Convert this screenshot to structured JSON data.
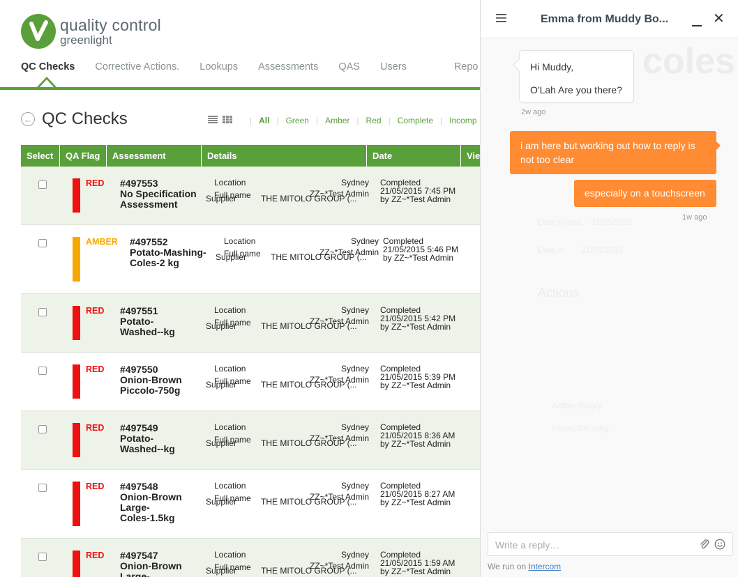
{
  "brand": {
    "name": "quality control",
    "sub": "greenlight"
  },
  "nav": [
    {
      "label": "QC Checks",
      "active": true
    },
    {
      "label": "Corrective Actions."
    },
    {
      "label": "Lookups"
    },
    {
      "label": "Assessments"
    },
    {
      "label": "QAS"
    },
    {
      "label": "Users"
    },
    {
      "label": "Repo"
    }
  ],
  "page": {
    "title": "QC Checks"
  },
  "filters": [
    "All",
    "Green",
    "Amber",
    "Red",
    "Complete",
    "Incomp"
  ],
  "table": {
    "headers": [
      "Select",
      "QA Flag",
      "Assessment",
      "Details",
      "Date",
      "Vie"
    ],
    "detail_labels": {
      "location": "Location",
      "fullname": "Full name",
      "supplier": "Supplier"
    },
    "rows": [
      {
        "flag": "RED",
        "id": "#497553",
        "name_lines": [
          "No Specification",
          "Assessment"
        ],
        "location": "Sydney",
        "fullname": "ZZ~*Test Admin",
        "supplier": "THE MITOLO GROUP (...",
        "status": "Completed",
        "date": "21/05/2015 7:45 PM",
        "by": "by ZZ~*Test Admin"
      },
      {
        "flag": "AMBER",
        "id": "#497552",
        "name_lines": [
          "Potato-Mashing-",
          "Coles-2 kg"
        ],
        "location": "Sydney",
        "fullname": "ZZ~*Test Admin",
        "supplier": "THE MITOLO GROUP (...",
        "status": "Completed",
        "date": "21/05/2015 5:46 PM",
        "by": "by ZZ~*Test Admin"
      },
      {
        "flag": "RED",
        "id": "#497551",
        "name_lines": [
          "Potato-",
          "Washed--kg"
        ],
        "location": "Sydney",
        "fullname": "ZZ~*Test Admin",
        "supplier": "THE MITOLO GROUP (...",
        "status": "Completed",
        "date": "21/05/2015 5:42 PM",
        "by": "by ZZ~*Test Admin"
      },
      {
        "flag": "RED",
        "id": "#497550",
        "name_lines": [
          "Onion-Brown",
          "Piccolo-750g"
        ],
        "location": "Sydney",
        "fullname": "ZZ~*Test Admin",
        "supplier": "THE MITOLO GROUP (...",
        "status": "Completed",
        "date": "21/05/2015 5:39 PM",
        "by": "by ZZ~*Test Admin"
      },
      {
        "flag": "RED",
        "id": "#497549",
        "name_lines": [
          "Potato-",
          "Washed--kg"
        ],
        "location": "Sydney",
        "fullname": "ZZ~*Test Admin",
        "supplier": "THE MITOLO GROUP (...",
        "status": "Completed",
        "date": "21/05/2015 8:36 AM",
        "by": "by ZZ~*Test Admin"
      },
      {
        "flag": "RED",
        "id": "#497548",
        "name_lines": [
          "Onion-Brown",
          "Large-",
          "Coles-1.5kg"
        ],
        "location": "Sydney",
        "fullname": "ZZ~*Test Admin",
        "supplier": "THE MITOLO GROUP (...",
        "status": "Completed",
        "date": "21/05/2015 8:27 AM",
        "by": "by ZZ~*Test Admin"
      },
      {
        "flag": "RED",
        "id": "#497547",
        "name_lines": [
          "Onion-Brown",
          "Large-"
        ],
        "location": "Sydney",
        "fullname": "ZZ~*Test Admin",
        "supplier": "THE MITOLO GROUP (...",
        "status": "Completed",
        "date": "21/05/2015 1:59 AM",
        "by": "by ZZ~*Test Admin"
      }
    ]
  },
  "chat": {
    "title": "Emma from Muddy Bo...",
    "incoming": {
      "line1": "Hi Muddy,",
      "line2": "O'Lah  Are you there?",
      "time": "2w ago"
    },
    "outgoing": [
      {
        "text": "i am here but working out how to reply is not too clear"
      },
      {
        "text": "especially on a touchscreen",
        "time": "1w ago"
      }
    ],
    "composer_placeholder": "Write a reply…",
    "powered_prefix": "We run on ",
    "powered_link": "Intercom"
  },
  "colors": {
    "green": "#5aa03a",
    "red": "#ee1111",
    "amber": "#f7a800",
    "orange": "#ff8b33"
  }
}
